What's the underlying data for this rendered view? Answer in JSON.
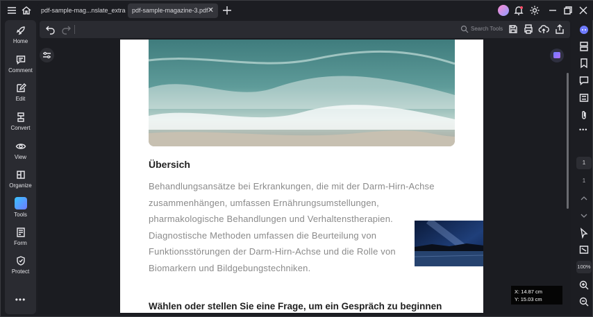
{
  "titlebar": {
    "tabs": [
      {
        "label": "pdf-sample-mag...nslate_extract.pdf",
        "active": false
      },
      {
        "label": "pdf-sample-magazine-3.pdf *",
        "active": true
      }
    ]
  },
  "toolbar": {
    "search_label": "Search Tools"
  },
  "leftnav": {
    "items": [
      {
        "label": "Home",
        "icon": "rocket-icon"
      },
      {
        "label": "Comment",
        "icon": "comment-icon"
      },
      {
        "label": "Edit",
        "icon": "edit-icon"
      },
      {
        "label": "Convert",
        "icon": "convert-icon"
      },
      {
        "label": "View",
        "icon": "eye-icon"
      },
      {
        "label": "Organize",
        "icon": "organize-icon"
      },
      {
        "label": "Tools",
        "icon": "tools-icon"
      },
      {
        "label": "Form",
        "icon": "form-icon"
      },
      {
        "label": "Protect",
        "icon": "shield-icon"
      }
    ]
  },
  "document": {
    "heading1": "Übersich",
    "paragraph_lines": [
      "Behandlungsansätze bei Erkrankungen, die mit der Darm-Hirn-Achse",
      "zusammenhängen, umfassen Ernährungsumstellungen,",
      "pharmakologische Behandlungen und Verhaltenstherapien.",
      "Diagnostische Methoden umfassen die Beurteilung von",
      "Funktionsstörungen der Darm-Hirn-Achse und die Rolle von",
      "Biomarkern und Bildgebungstechniken."
    ],
    "heading2": "Wählen oder stellen Sie eine Frage, um ein Gespräch zu beginnen"
  },
  "pagenav": {
    "current_page": "1",
    "total_pages": "1",
    "zoom": "100%"
  },
  "coords": {
    "x": "X: 14.87 cm",
    "y": "Y: 15.03 cm"
  },
  "colors": {
    "accent": "#6f7bff",
    "panel": "#2a2b31",
    "background": "#1c1d22"
  }
}
